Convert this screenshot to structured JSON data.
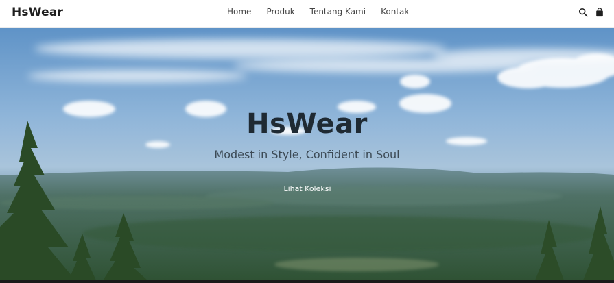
{
  "header": {
    "brand": "HsWear",
    "nav": [
      {
        "label": "Home"
      },
      {
        "label": "Produk"
      },
      {
        "label": "Tentang Kami"
      },
      {
        "label": "Kontak"
      }
    ],
    "icons": [
      "search-icon",
      "shopping-bag-icon"
    ]
  },
  "hero": {
    "title": "HsWear",
    "tagline": "Modest in Style, Confident in Soul",
    "cta_label": "Lihat Koleksi"
  },
  "colors": {
    "nav_text": "#444444",
    "title_text": "#1f2a33",
    "tagline_text": "#3c4a55",
    "cta_text": "#ffffff"
  }
}
